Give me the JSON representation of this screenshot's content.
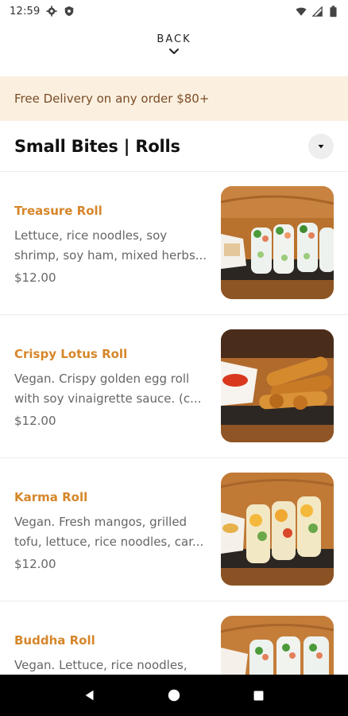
{
  "status_bar": {
    "time": "12:59",
    "left_icons": [
      "gear-icon",
      "shield-icon"
    ],
    "right_icons": [
      "wifi-icon",
      "signal-icon",
      "battery-icon"
    ]
  },
  "back": {
    "label": "BACK",
    "icon": "chevron-down-icon"
  },
  "promo": {
    "text": "Free Delivery on any order $80+"
  },
  "section": {
    "title": "Small Bites | Rolls",
    "dropdown_icon": "caret-down-icon"
  },
  "menu_items": [
    {
      "name": "Treasure Roll",
      "description": "Lettuce, rice noodles, soy shrimp, soy ham, mixed herbs...",
      "price": "$12.00",
      "image": "treasure-roll-photo"
    },
    {
      "name": "Crispy Lotus Roll",
      "description": "Vegan. Crispy golden egg roll with soy vinaigrette sauce. (c...",
      "price": "$12.00",
      "image": "crispy-lotus-roll-photo"
    },
    {
      "name": "Karma Roll",
      "description": "Vegan. Fresh mangos, grilled tofu, lettuce, rice noodles, car...",
      "price": "$12.00",
      "image": "karma-roll-photo"
    },
    {
      "name": "Buddha Roll",
      "description": "Vegan. Lettuce, rice noodles,",
      "price": "",
      "image": "buddha-roll-photo"
    }
  ],
  "nav_bar": {
    "buttons": [
      "back-triangle-icon",
      "home-circle-icon",
      "recents-square-icon"
    ]
  },
  "colors": {
    "accent": "#d6862a",
    "promo_bg": "#fbf0e0",
    "promo_text": "#7a4b26",
    "text_secondary": "#666666"
  }
}
